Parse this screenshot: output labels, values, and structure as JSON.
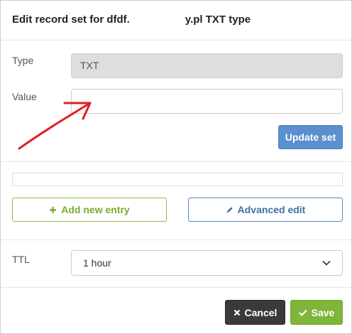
{
  "dialog": {
    "title_prefix": "Edit record set for dfdf.",
    "title_suffix": "y.pl TXT type"
  },
  "form": {
    "type_label": "Type",
    "type_value": "TXT",
    "value_label": "Value",
    "value_input": "",
    "value_placeholder": "",
    "update_button": "Update set"
  },
  "actions": {
    "add_entry": "Add new entry",
    "advanced_edit": "Advanced edit"
  },
  "ttl": {
    "label": "TTL",
    "selected": "1 hour"
  },
  "footer": {
    "cancel": "Cancel",
    "save": "Save"
  },
  "colors": {
    "update_blue": "#5b8fce",
    "add_green": "#7aad2a",
    "advanced_blue": "#3f6fa8",
    "cancel_dark": "#3a3a3a",
    "save_green": "#7fb63a",
    "annotation_red": "#e02020"
  },
  "icons": {
    "add": "plus-icon",
    "advanced": "pencil-icon",
    "cancel": "close-icon",
    "save": "check-icon",
    "select": "chevron-down-icon",
    "annotation": "red-arrow-annotation"
  }
}
